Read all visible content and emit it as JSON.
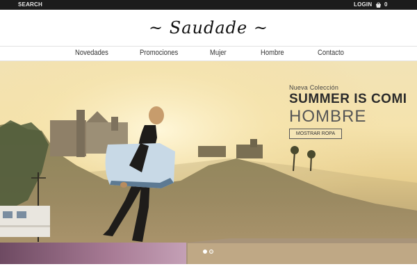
{
  "topbar": {
    "search_label": "SEARCH",
    "login_label": "LOGIN",
    "cart_icon": "shopping-bag-icon",
    "cart_count": "0"
  },
  "brand": {
    "logo_text": "~ Saudade ~"
  },
  "nav": {
    "items": [
      {
        "label": "Novedades"
      },
      {
        "label": "Promociones"
      },
      {
        "label": "Mujer"
      },
      {
        "label": "Hombre"
      },
      {
        "label": "Contacto"
      }
    ]
  },
  "hero": {
    "subtitle": "Nueva Colección",
    "title": "SUMMER IS COMI",
    "title2": "HOMBRE",
    "button_label": "MOSTRAR ROPA",
    "slides_total": 2,
    "active_slide": 1
  },
  "colors": {
    "topbar_bg": "#1c1c1c",
    "hero_sky": "#f5e3ad",
    "promo_text": "#2b2b2b"
  }
}
